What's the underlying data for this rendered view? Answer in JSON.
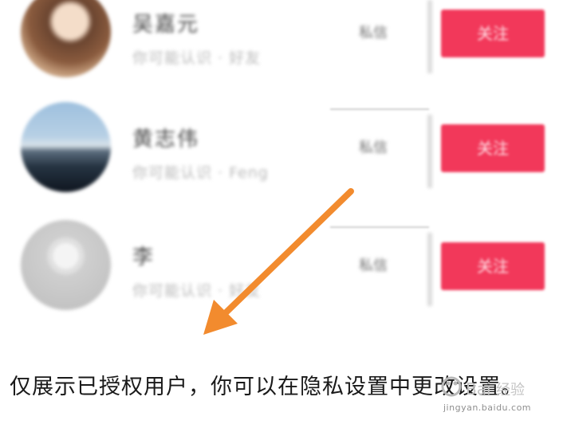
{
  "users": [
    {
      "name": "吴嘉元",
      "subtitle": "你可能认识 · 好友",
      "message_label": "私信",
      "follow_label": "关注"
    },
    {
      "name": "黄志伟",
      "subtitle": "你可能认识 · Feng",
      "message_label": "私信",
      "follow_label": "关注"
    },
    {
      "name": "李",
      "subtitle": "你可能认识 · 好友",
      "message_label": "私信",
      "follow_label": "关注"
    }
  ],
  "caption": "仅展示已授权用户，你可以在隐私设置中更改设置。",
  "watermark": {
    "brand": "Baidu经验",
    "url": "jingyan.baidu.com"
  },
  "colors": {
    "follow_button": "#f2385a",
    "arrow": "#f28b2e"
  }
}
